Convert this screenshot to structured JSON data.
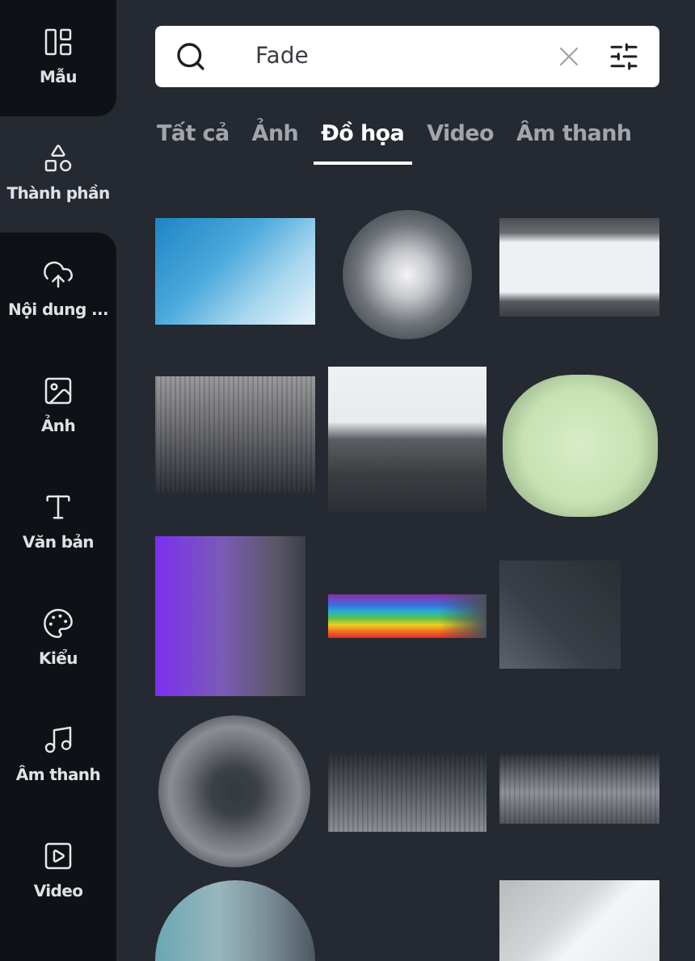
{
  "sidebar": {
    "items": [
      {
        "kind": "templates",
        "label": "Mẫu",
        "selected": false
      },
      {
        "kind": "elements",
        "label": "Thành phần",
        "selected": true
      },
      {
        "kind": "uploads",
        "label": "Nội dung ...",
        "selected": false
      },
      {
        "kind": "photos",
        "label": "Ảnh",
        "selected": false
      },
      {
        "kind": "text",
        "label": "Văn bản",
        "selected": false
      },
      {
        "kind": "styles",
        "label": "Kiểu",
        "selected": false
      },
      {
        "kind": "audio",
        "label": "Âm thanh",
        "selected": false
      },
      {
        "kind": "video",
        "label": "Video",
        "selected": false
      }
    ]
  },
  "search": {
    "value": "Fade"
  },
  "tabs": [
    {
      "label": "Tất cả",
      "selected": false
    },
    {
      "label": "Ảnh",
      "selected": false
    },
    {
      "label": "Đồ họa",
      "selected": true
    },
    {
      "label": "Video",
      "selected": false
    },
    {
      "label": "Âm thanh",
      "selected": false
    }
  ],
  "results": {
    "columns": [
      [
        {
          "kind": "blue-texture"
        },
        {
          "kind": "halftone-fade"
        },
        {
          "kind": "purple-fade"
        },
        {
          "kind": "radial-burst"
        },
        {
          "kind": "glass-sphere"
        }
      ],
      [
        {
          "kind": "soft-glow"
        },
        {
          "kind": "treeline"
        },
        {
          "kind": "rainbow-stripe"
        },
        {
          "kind": "halftone-band"
        }
      ],
      [
        {
          "kind": "brush-strip"
        },
        {
          "kind": "green-cloud"
        },
        {
          "kind": "dark-square"
        },
        {
          "kind": "grey-band"
        },
        {
          "kind": "white-diagonal"
        }
      ]
    ]
  }
}
